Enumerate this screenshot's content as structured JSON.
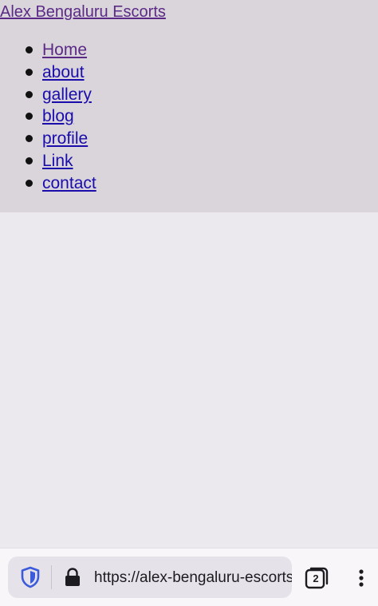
{
  "header": {
    "site_title": "Alex Bengaluru Escorts",
    "nav": [
      {
        "label": "Home"
      },
      {
        "label": "about"
      },
      {
        "label": "gallery"
      },
      {
        "label": "blog"
      },
      {
        "label": "profile"
      },
      {
        "label": "Link"
      },
      {
        "label": "contact"
      }
    ]
  },
  "browser": {
    "url": "https://alex-bengaluru-escorts",
    "tab_count": "2",
    "icons": {
      "shield": "shield-icon",
      "lock": "lock-icon",
      "tabs": "tabs-icon",
      "menu": "more-vert-icon"
    }
  },
  "colors": {
    "header_bg": "#d9d5da",
    "page_bg": "#ece9ee",
    "link": "#1a0dab",
    "visited_link": "#5b2a86",
    "shield_accent": "#3b5bdb"
  }
}
